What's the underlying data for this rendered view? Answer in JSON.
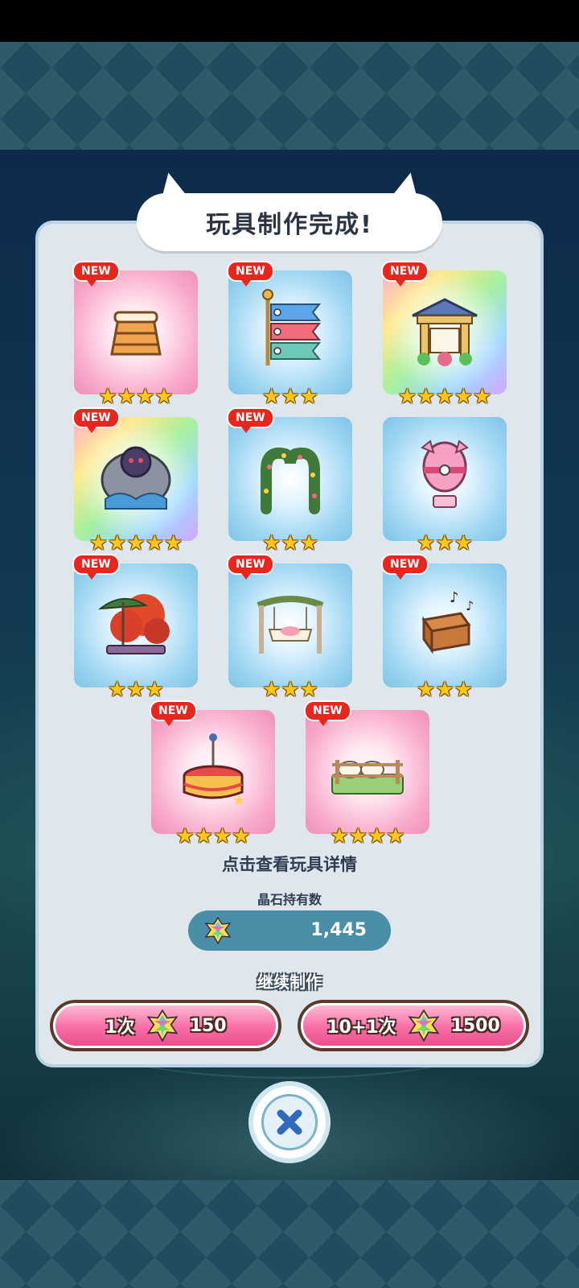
{
  "dialog": {
    "title": "玩具制作完成!",
    "new_label": "NEW",
    "hint": "点击查看玩具详情",
    "currency_label": "晶石持有数",
    "currency_value": "1,445",
    "continue_label": "继续制作",
    "buttons": [
      {
        "label": "1次",
        "cost": "150"
      },
      {
        "label": "10+1次",
        "cost": "1500"
      }
    ]
  },
  "items": [
    {
      "name": "vaulting-box",
      "stars": 4,
      "star_text": "★★★★",
      "glow": "pink"
    },
    {
      "name": "koinobori",
      "stars": 3,
      "star_text": "★★★",
      "glow": "blue"
    },
    {
      "name": "shrine-gate",
      "stars": 5,
      "star_text": "★★★★★",
      "glow": "rainbow"
    },
    {
      "name": "stone-monster-statue",
      "stars": 5,
      "star_text": "★★★★★",
      "glow": "rainbow"
    },
    {
      "name": "heart-flower-arch",
      "stars": 3,
      "star_text": "★★★",
      "glow": "blue"
    },
    {
      "name": "pink-hot-air-balloon",
      "stars": 3,
      "star_text": "★★★",
      "glow": "blue"
    },
    {
      "name": "maple-tree-parasol",
      "stars": 3,
      "star_text": "★★★",
      "glow": "blue"
    },
    {
      "name": "garden-swing",
      "stars": 3,
      "star_text": "★★★",
      "glow": "blue"
    },
    {
      "name": "music-box",
      "stars": 3,
      "star_text": "★★★",
      "glow": "blue"
    },
    {
      "name": "circus-stage",
      "stars": 4,
      "star_text": "★★★★",
      "glow": "pink"
    },
    {
      "name": "sheep-fence",
      "stars": 4,
      "star_text": "★★★★",
      "glow": "pink"
    }
  ],
  "colors": {
    "accent_pink": "#f76ea6",
    "new_badge": "#e8261d",
    "star": "#ffc718",
    "panel": "#dfe6ec",
    "currency_pill": "#4a8ea8"
  }
}
